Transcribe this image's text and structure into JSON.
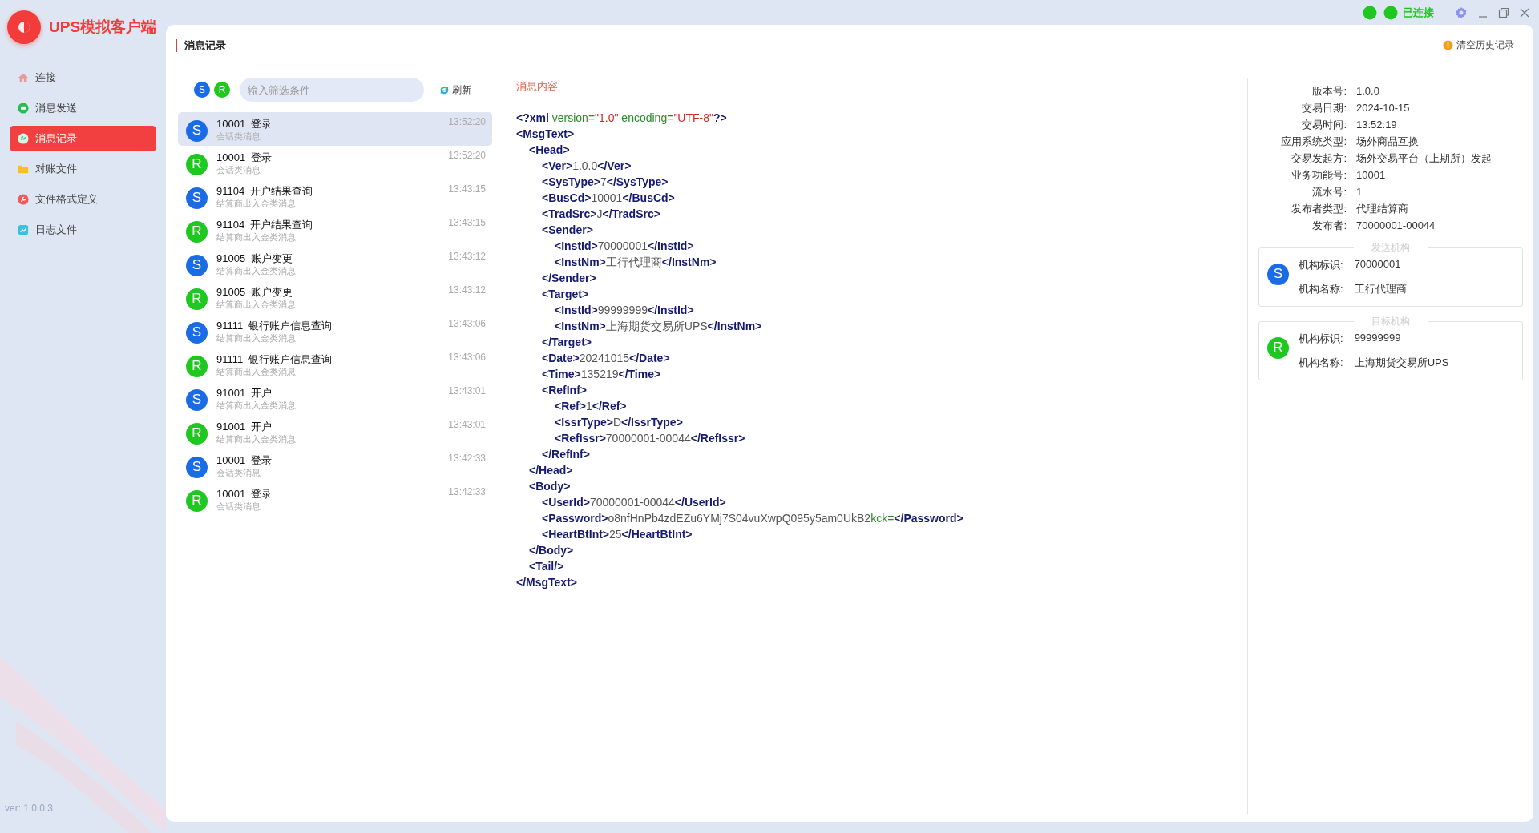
{
  "app": {
    "title": "UPS模拟客户端",
    "version": "ver: 1.0.0.3"
  },
  "connection": {
    "label": "已连接",
    "connected": true
  },
  "sidebar": {
    "items": [
      {
        "label": "连接",
        "selected": false
      },
      {
        "label": "消息发送",
        "selected": false
      },
      {
        "label": "消息记录",
        "selected": true
      },
      {
        "label": "对账文件",
        "selected": false
      },
      {
        "label": "文件格式定义",
        "selected": false
      },
      {
        "label": "日志文件",
        "selected": false
      }
    ]
  },
  "page": {
    "title": "消息记录",
    "clear_history": "清空历史记录"
  },
  "filters": [
    {
      "label": "S",
      "kind": "send"
    },
    {
      "label": "R",
      "kind": "receive"
    }
  ],
  "search": {
    "placeholder": "输入筛选条件"
  },
  "refresh": "刷新",
  "messages": [
    {
      "badge": "S",
      "kind": "send",
      "code": "10001",
      "name": "登录",
      "category": "会话类消息",
      "time": "13:52:20",
      "selected": true
    },
    {
      "badge": "R",
      "kind": "receive",
      "code": "10001",
      "name": "登录",
      "category": "会话类消息",
      "time": "13:52:20",
      "selected": false
    },
    {
      "badge": "S",
      "kind": "send",
      "code": "91104",
      "name": "开户结果查询",
      "category": "结算商出入金类消息",
      "time": "13:43:15",
      "selected": false
    },
    {
      "badge": "R",
      "kind": "receive",
      "code": "91104",
      "name": "开户结果查询",
      "category": "结算商出入金类消息",
      "time": "13:43:15",
      "selected": false
    },
    {
      "badge": "S",
      "kind": "send",
      "code": "91005",
      "name": "账户变更",
      "category": "结算商出入金类消息",
      "time": "13:43:12",
      "selected": false
    },
    {
      "badge": "R",
      "kind": "receive",
      "code": "91005",
      "name": "账户变更",
      "category": "结算商出入金类消息",
      "time": "13:43:12",
      "selected": false
    },
    {
      "badge": "S",
      "kind": "send",
      "code": "91111",
      "name": "银行账户信息查询",
      "category": "结算商出入金类消息",
      "time": "13:43:06",
      "selected": false
    },
    {
      "badge": "R",
      "kind": "receive",
      "code": "91111",
      "name": "银行账户信息查询",
      "category": "结算商出入金类消息",
      "time": "13:43:06",
      "selected": false
    },
    {
      "badge": "S",
      "kind": "send",
      "code": "91001",
      "name": "开户",
      "category": "结算商出入金类消息",
      "time": "13:43:01",
      "selected": false
    },
    {
      "badge": "R",
      "kind": "receive",
      "code": "91001",
      "name": "开户",
      "category": "结算商出入金类消息",
      "time": "13:43:01",
      "selected": false
    },
    {
      "badge": "S",
      "kind": "send",
      "code": "10001",
      "name": "登录",
      "category": "会话类消息",
      "time": "13:42:33",
      "selected": false
    },
    {
      "badge": "R",
      "kind": "receive",
      "code": "10001",
      "name": "登录",
      "category": "会话类消息",
      "time": "13:42:33",
      "selected": false
    }
  ],
  "content": {
    "title": "消息内容",
    "xml": [
      {
        "line": [
          {
            "kind": "tag",
            "text": "<?xml"
          },
          {
            "kind": "attr",
            "text": " version="
          },
          {
            "kind": "string",
            "text": "\"1.0\""
          },
          {
            "kind": "attr",
            "text": " encoding="
          },
          {
            "kind": "string",
            "text": "\"UTF-8\""
          },
          {
            "kind": "tag",
            "text": "?>"
          }
        ]
      },
      {
        "line": [
          {
            "kind": "tag",
            "text": "<MsgText>"
          }
        ],
        "close": [
          {
            "kind": "tag",
            "text": "</MsgText>"
          }
        ],
        "children": [
          {
            "line": [
              {
                "kind": "tag",
                "text": "<Head>"
              }
            ],
            "close": [
              {
                "kind": "tag",
                "text": "</Head>"
              }
            ],
            "children": [
              {
                "line": [
                  {
                    "kind": "tag",
                    "text": "<Ver>"
                  },
                  {
                    "kind": "text",
                    "text": "1.0.0"
                  },
                  {
                    "kind": "tag",
                    "text": "</Ver>"
                  }
                ]
              },
              {
                "line": [
                  {
                    "kind": "tag",
                    "text": "<SysType>"
                  },
                  {
                    "kind": "text",
                    "text": "7"
                  },
                  {
                    "kind": "tag",
                    "text": "</SysType>"
                  }
                ]
              },
              {
                "line": [
                  {
                    "kind": "tag",
                    "text": "<BusCd>"
                  },
                  {
                    "kind": "text",
                    "text": "10001"
                  },
                  {
                    "kind": "tag",
                    "text": "</BusCd>"
                  }
                ]
              },
              {
                "line": [
                  {
                    "kind": "tag",
                    "text": "<TradSrc>"
                  },
                  {
                    "kind": "text",
                    "text": "J"
                  },
                  {
                    "kind": "tag",
                    "text": "</TradSrc>"
                  }
                ]
              },
              {
                "line": [
                  {
                    "kind": "tag",
                    "text": "<Sender>"
                  }
                ],
                "close": [
                  {
                    "kind": "tag",
                    "text": "</Sender>"
                  }
                ],
                "children": [
                  {
                    "line": [
                      {
                        "kind": "tag",
                        "text": "<InstId>"
                      },
                      {
                        "kind": "text",
                        "text": "70000001"
                      },
                      {
                        "kind": "tag",
                        "text": "</InstId>"
                      }
                    ]
                  },
                  {
                    "line": [
                      {
                        "kind": "tag",
                        "text": "<InstNm>"
                      },
                      {
                        "kind": "text",
                        "text": "工行代理商"
                      },
                      {
                        "kind": "tag",
                        "text": "</InstNm>"
                      }
                    ]
                  }
                ]
              },
              {
                "line": [
                  {
                    "kind": "tag",
                    "text": "<Target>"
                  }
                ],
                "close": [
                  {
                    "kind": "tag",
                    "text": "</Target>"
                  }
                ],
                "children": [
                  {
                    "line": [
                      {
                        "kind": "tag",
                        "text": "<InstId>"
                      },
                      {
                        "kind": "text",
                        "text": "99999999"
                      },
                      {
                        "kind": "tag",
                        "text": "</InstId>"
                      }
                    ]
                  },
                  {
                    "line": [
                      {
                        "kind": "tag",
                        "text": "<InstNm>"
                      },
                      {
                        "kind": "text",
                        "text": "上海期货交易所UPS"
                      },
                      {
                        "kind": "tag",
                        "text": "</InstNm>"
                      }
                    ]
                  }
                ]
              },
              {
                "line": [
                  {
                    "kind": "tag",
                    "text": "<Date>"
                  },
                  {
                    "kind": "text",
                    "text": "20241015"
                  },
                  {
                    "kind": "tag",
                    "text": "</Date>"
                  }
                ]
              },
              {
                "line": [
                  {
                    "kind": "tag",
                    "text": "<Time>"
                  },
                  {
                    "kind": "text",
                    "text": "135219"
                  },
                  {
                    "kind": "tag",
                    "text": "</Time>"
                  }
                ]
              },
              {
                "line": [
                  {
                    "kind": "tag",
                    "text": "<RefInf>"
                  }
                ],
                "close": [
                  {
                    "kind": "tag",
                    "text": "</RefInf>"
                  }
                ],
                "children": [
                  {
                    "line": [
                      {
                        "kind": "tag",
                        "text": "<Ref>"
                      },
                      {
                        "kind": "text",
                        "text": "1"
                      },
                      {
                        "kind": "tag",
                        "text": "</Ref>"
                      }
                    ]
                  },
                  {
                    "line": [
                      {
                        "kind": "tag",
                        "text": "<IssrType>"
                      },
                      {
                        "kind": "text",
                        "text": "D"
                      },
                      {
                        "kind": "tag",
                        "text": "</IssrType>"
                      }
                    ]
                  },
                  {
                    "line": [
                      {
                        "kind": "tag",
                        "text": "<RefIssr>"
                      },
                      {
                        "kind": "text",
                        "text": "70000001-00044"
                      },
                      {
                        "kind": "tag",
                        "text": "</RefIssr>"
                      }
                    ]
                  }
                ]
              }
            ]
          },
          {
            "line": [
              {
                "kind": "tag",
                "text": "<Body>"
              }
            ],
            "close": [
              {
                "kind": "tag",
                "text": "</Body>"
              }
            ],
            "children": [
              {
                "line": [
                  {
                    "kind": "tag",
                    "text": "<UserId>"
                  },
                  {
                    "kind": "text",
                    "text": "70000001-00044"
                  },
                  {
                    "kind": "tag",
                    "text": "</UserId>"
                  }
                ]
              },
              {
                "line": [
                  {
                    "kind": "tag",
                    "text": "<Password>"
                  },
                  {
                    "kind": "text",
                    "text": "o8nfHnPb4zdEZu6YMj7S04vuXwpQ095y5am0UkB2"
                  },
                  {
                    "kind": "attr",
                    "text": "kck="
                  },
                  {
                    "kind": "tag",
                    "text": "</Password>"
                  }
                ]
              },
              {
                "line": [
                  {
                    "kind": "tag",
                    "text": "<HeartBtInt>"
                  },
                  {
                    "kind": "text",
                    "text": "25"
                  },
                  {
                    "kind": "tag",
                    "text": "</HeartBtInt>"
                  }
                ]
              }
            ]
          },
          {
            "line": [
              {
                "kind": "tag",
                "text": "<Tail/>"
              }
            ]
          }
        ]
      }
    ]
  },
  "details": [
    {
      "label": "版本号:",
      "value": "1.0.0"
    },
    {
      "label": "交易日期:",
      "value": "2024-10-15"
    },
    {
      "label": "交易时间:",
      "value": "13:52:19"
    },
    {
      "label": "应用系统类型:",
      "value": "场外商品互换"
    },
    {
      "label": "交易发起方:",
      "value": "场外交易平台（上期所）发起"
    },
    {
      "label": "业务功能号:",
      "value": "10001"
    },
    {
      "label": "流水号:",
      "value": "1"
    },
    {
      "label": "发布者类型:",
      "value": "代理结算商"
    },
    {
      "label": "发布者:",
      "value": "70000001-00044"
    }
  ],
  "institutions": [
    {
      "title": "发送机构",
      "badge": "S",
      "kind": "send",
      "fields": [
        {
          "label": "机构标识:",
          "value": "70000001"
        },
        {
          "label": "机构名称:",
          "value": "工行代理商"
        }
      ]
    },
    {
      "title": "目标机构",
      "badge": "R",
      "kind": "receive",
      "fields": [
        {
          "label": "机构标识:",
          "value": "99999999"
        },
        {
          "label": "机构名称:",
          "value": "上海期货交易所UPS"
        }
      ]
    }
  ]
}
